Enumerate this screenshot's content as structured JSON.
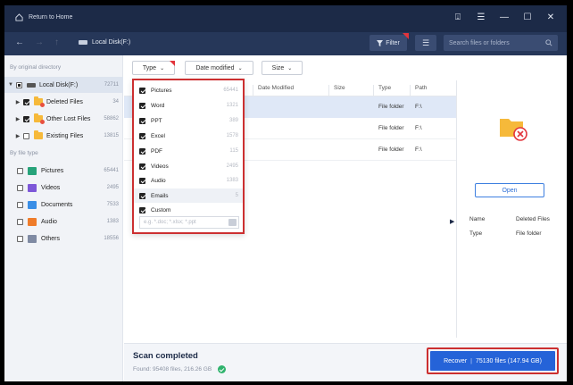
{
  "titlebar": {
    "home_label": "Return to Home"
  },
  "nav": {
    "location": "Local Disk(F:)",
    "filter_label": "Filter",
    "search_placeholder": "Search files or folders"
  },
  "sidebar": {
    "by_dir_heading": "By original directory",
    "by_type_heading": "By file type",
    "tree": [
      {
        "label": "Local Disk(F:)",
        "count": "72711"
      },
      {
        "label": "Deleted Files",
        "count": "34"
      },
      {
        "label": "Other Lost Files",
        "count": "58862"
      },
      {
        "label": "Existing Files",
        "count": "13815"
      }
    ],
    "types": [
      {
        "label": "Pictures",
        "count": "65441",
        "color": "#27a37a"
      },
      {
        "label": "Videos",
        "count": "2495",
        "color": "#7d57d8"
      },
      {
        "label": "Documents",
        "count": "7533",
        "color": "#3a8ee6"
      },
      {
        "label": "Audio",
        "count": "1383",
        "color": "#ef7c2a"
      },
      {
        "label": "Others",
        "count": "18556",
        "color": "#7f8aa3"
      }
    ]
  },
  "filters": {
    "type": "Type",
    "date_modified": "Date modified",
    "size": "Size"
  },
  "table": {
    "headers": {
      "date": "Date Modified",
      "size": "Size",
      "type": "Type",
      "path": "Path"
    },
    "rows": [
      {
        "type": "File folder",
        "path": "F:\\"
      },
      {
        "type": "File folder",
        "path": "F:\\"
      },
      {
        "type": "File folder",
        "path": "F:\\"
      }
    ]
  },
  "dropdown": {
    "items": [
      {
        "label": "Pictures",
        "count": "65441"
      },
      {
        "label": "Word",
        "count": "1321"
      },
      {
        "label": "PPT",
        "count": "389"
      },
      {
        "label": "Excel",
        "count": "1578"
      },
      {
        "label": "PDF",
        "count": "115"
      },
      {
        "label": "Videos",
        "count": "2495"
      },
      {
        "label": "Audio",
        "count": "1383"
      },
      {
        "label": "Emails",
        "count": "5"
      },
      {
        "label": "Custom",
        "count": ""
      }
    ],
    "custom_placeholder": "e.g. *.doc; *.xlsx; *.ppt"
  },
  "preview": {
    "open_label": "Open",
    "name_label": "Name",
    "name_value": "Deleted Files",
    "type_label": "Type",
    "type_value": "File folder"
  },
  "status": {
    "title": "Scan completed",
    "found": "Found: 95408 files, 216.26 GB",
    "recover_label": "Recover",
    "recover_detail": "75130 files (147.94 GB)"
  },
  "colors": {
    "accent": "#2563d8",
    "titlebar": "#1c2a47",
    "highlight_border": "#cc2f30"
  }
}
